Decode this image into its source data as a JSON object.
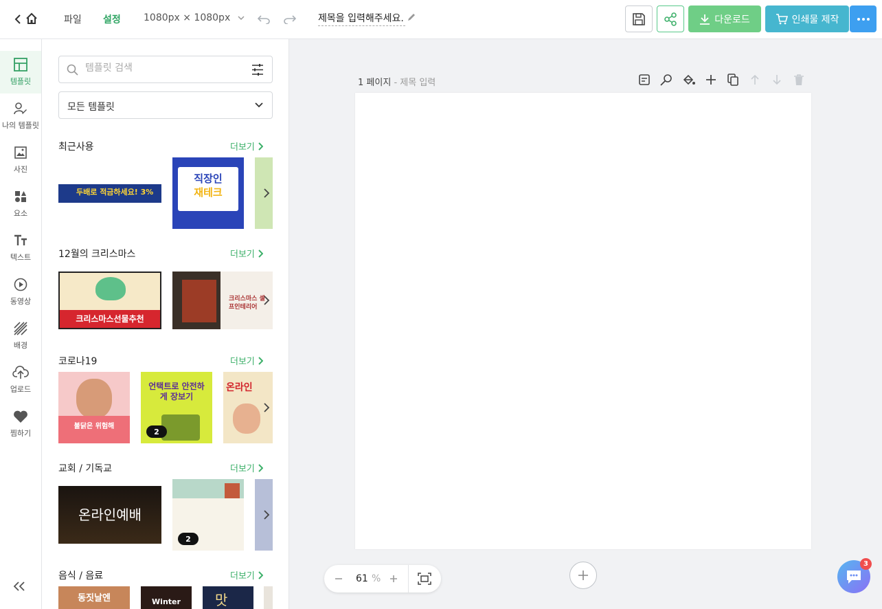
{
  "header": {
    "menu_file": "파일",
    "menu_settings": "설정",
    "canvas_size": "1080px × 1080px",
    "doc_title": "제목을 입력해주세요.",
    "download_label": "다운로드",
    "print_label": "인쇄물 제작"
  },
  "nav": {
    "items": [
      {
        "label": "템플릿",
        "icon": "layout-icon"
      },
      {
        "label": "나의 템플릿",
        "icon": "user-edit-icon"
      },
      {
        "label": "사진",
        "icon": "image-icon"
      },
      {
        "label": "요소",
        "icon": "shapes-icon"
      },
      {
        "label": "텍스트",
        "icon": "text-icon"
      },
      {
        "label": "동영상",
        "icon": "play-icon"
      },
      {
        "label": "배경",
        "icon": "pattern-icon"
      },
      {
        "label": "업로드",
        "icon": "upload-icon"
      },
      {
        "label": "찜하기",
        "icon": "heart-icon"
      }
    ]
  },
  "panel": {
    "search_placeholder": "템플릿 검색",
    "filter_value": "모든 템플릿",
    "more_label": "더보기",
    "sections": [
      {
        "title": "최근사용"
      },
      {
        "title": "12월의 크리스마스"
      },
      {
        "title": "코로나19"
      },
      {
        "title": "교회 / 기독교"
      },
      {
        "title": "음식 / 음료"
      }
    ],
    "thumb_texts": {
      "recent_1": "두배로 적금하세요! 3%",
      "recent_2_a": "직장인",
      "recent_2_b": "재테크",
      "xmas_1": "크리스마스선물추천",
      "xmas_2": "크리스마스 셀프인테리어",
      "corona_1": "불닭은 위험해",
      "corona_2": "언택트로 안전하게 장보기",
      "corona_3": "온라인",
      "church_1": "온라인예배",
      "food_1": "동짓날엔",
      "food_2": "Winter",
      "food_3": "맛"
    },
    "badges": {
      "corona_2": "2",
      "church_2": "2"
    }
  },
  "canvas": {
    "page_number": "1 페이지",
    "page_title_placeholder": "- 제목 입력",
    "zoom_value": "61",
    "zoom_unit": "%"
  },
  "chat": {
    "badge_count": "3"
  }
}
